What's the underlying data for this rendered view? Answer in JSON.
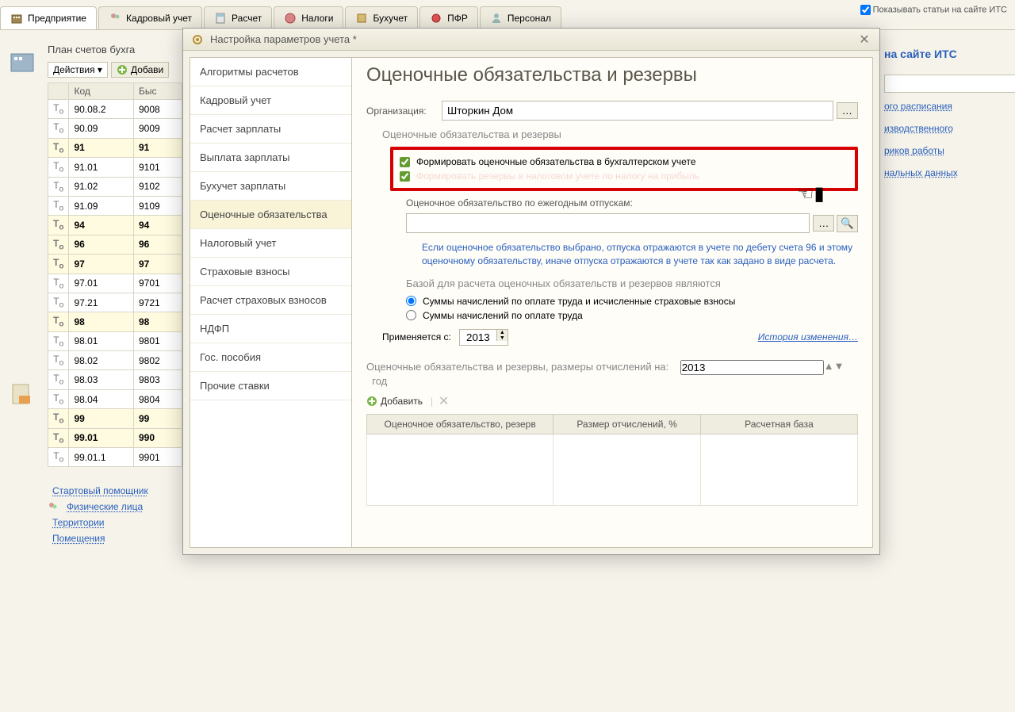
{
  "top_tabs": [
    "Предприятие",
    "Кадровый учет",
    "Расчет",
    "Налоги",
    "Бухучет",
    "ПФР",
    "Персонал"
  ],
  "right_check": "Показывать статьи на сайте ИТС",
  "bg": {
    "title": "План счетов бухга",
    "actions": "Действия ▾",
    "add": "Добави",
    "th_code": "Код",
    "th_fast": "Быс",
    "rows": [
      {
        "code": "90.08.2",
        "s": "9008",
        "b": false
      },
      {
        "code": "90.09",
        "s": "9009",
        "b": false
      },
      {
        "code": "91",
        "s": "91",
        "b": true
      },
      {
        "code": "91.01",
        "s": "9101",
        "b": false
      },
      {
        "code": "91.02",
        "s": "9102",
        "b": false
      },
      {
        "code": "91.09",
        "s": "9109",
        "b": false
      },
      {
        "code": "94",
        "s": "94",
        "b": true
      },
      {
        "code": "96",
        "s": "96",
        "b": true
      },
      {
        "code": "97",
        "s": "97",
        "b": true
      },
      {
        "code": "97.01",
        "s": "9701",
        "b": false
      },
      {
        "code": "97.21",
        "s": "9721",
        "b": false
      },
      {
        "code": "98",
        "s": "98",
        "b": true
      },
      {
        "code": "98.01",
        "s": "9801",
        "b": false
      },
      {
        "code": "98.02",
        "s": "9802",
        "b": false
      },
      {
        "code": "98.03",
        "s": "9803",
        "b": false
      },
      {
        "code": "98.04",
        "s": "9804",
        "b": false
      },
      {
        "code": "99",
        "s": "99",
        "b": true
      },
      {
        "code": "99.01",
        "s": "990",
        "b": true
      },
      {
        "code": "99.01.1",
        "s": "9901",
        "b": false
      }
    ],
    "links": [
      "Стартовый помощник",
      "Физические лица",
      "Территории",
      "Помещения"
    ]
  },
  "right": {
    "title": "на сайте ИТС",
    "links": [
      "ого расписания",
      "изводственного",
      "риков работы",
      "нальных данных"
    ]
  },
  "modal": {
    "title": "Настройка параметров учета *",
    "nav": [
      "Алгоритмы расчетов",
      "Кадровый учет",
      "Расчет зарплаты",
      "Выплата зарплаты",
      "Бухучет зарплаты",
      "Оценочные обязательства",
      "Налоговый учет",
      "Страховые взносы",
      "Расчет страховых взносов",
      "НДФП",
      "Гос. пособия",
      "Прочие ставки"
    ],
    "nav_selected": 5,
    "heading": "Оценочные обязательства и резервы",
    "org_label": "Организация:",
    "org_value": "Шторкин Дом",
    "group_title": "Оценочные обязательства и резервы",
    "chk1": "Формировать оценочные обязательства в бухгалтерском учете",
    "chk2": "Формировать резервы в налоговом учете по налогу на прибыль",
    "field_label": "Оценочное обязательство по ежегодным отпускам:",
    "hint": "Если оценочное обязательство выбрано, отпуска отражаются в учете по дебету счета 96 и этому оценочному обязательству, иначе отпуска отражаются в учете так как задано в виде расчета.",
    "base_title": "Базой для расчета оценочных обязательств и резервов являются",
    "radio1": "Суммы начислений по оплате труда и исчисленные страховые взносы",
    "radio2": "Суммы начислений по оплате труда",
    "apply_from": "Применяется с:",
    "year1": "2013",
    "history": "История изменения…",
    "sizes_title": "Оценочные обязательства и резервы, размеры отчислений на:",
    "year2": "2013",
    "year_suffix": "год",
    "add_row": "Добавить",
    "grid_cols": [
      "Оценочное обязательство, резерв",
      "Размер отчислений, %",
      "Расчетная база"
    ]
  }
}
